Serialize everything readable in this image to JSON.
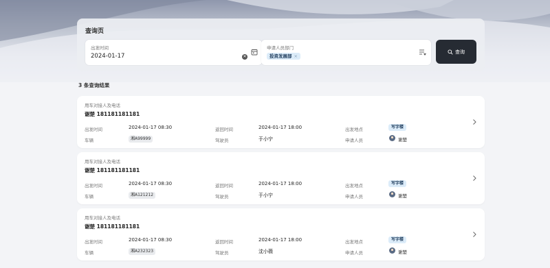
{
  "search": {
    "title": "查询页",
    "depart_time": {
      "label": "出发时间",
      "value": "2024-01-17"
    },
    "department": {
      "label": "申请人员部门",
      "tag": "投资发展部",
      "tag_close": "×"
    },
    "query_button": "查询"
  },
  "results": {
    "count_text": "3 条查询结果",
    "items": [
      {
        "contact_label": "用车对接人及电话",
        "contact": "谢楚 181181181181",
        "depart_label": "出发时间",
        "depart_time": "2024-01-17 08:30",
        "return_label": "返回时间",
        "return_time": "2024-01-17 18:00",
        "location_label": "出发地点",
        "location": "写字楼",
        "vehicle_label": "车辆",
        "vehicle": "湘A99999",
        "driver_label": "驾驶员",
        "driver": "于小宁",
        "applicant_label": "申请人员",
        "applicant": "谢楚"
      },
      {
        "contact_label": "用车对接人及电话",
        "contact": "谢楚 181181181181",
        "depart_label": "出发时间",
        "depart_time": "2024-01-17 08:30",
        "return_label": "返回时间",
        "return_time": "2024-01-17 18:00",
        "location_label": "出发地点",
        "location": "写字楼",
        "vehicle_label": "车辆",
        "vehicle": "湘A121212",
        "driver_label": "驾驶员",
        "driver": "于小宁",
        "applicant_label": "申请人员",
        "applicant": "谢楚"
      },
      {
        "contact_label": "用车对接人及电话",
        "contact": "谢楚 181181181181",
        "depart_label": "出发时间",
        "depart_time": "2024-01-17 08:30",
        "return_label": "返回时间",
        "return_time": "2024-01-17 18:00",
        "location_label": "出发地点",
        "location": "写字楼",
        "vehicle_label": "车辆",
        "vehicle": "湘A232323",
        "driver_label": "驾驶员",
        "driver": "沈小薇",
        "applicant_label": "申请人员",
        "applicant": "谢楚"
      }
    ]
  },
  "icons": {
    "clear": "clear-icon",
    "calendar": "calendar-icon",
    "filter": "filter-list-icon",
    "search": "search-icon",
    "chevron": "chevron-right-icon"
  },
  "colors": {
    "query_button_bg": "#262b33",
    "tag_bg": "#dcecf9",
    "page_bg": "#f3f4f7"
  }
}
